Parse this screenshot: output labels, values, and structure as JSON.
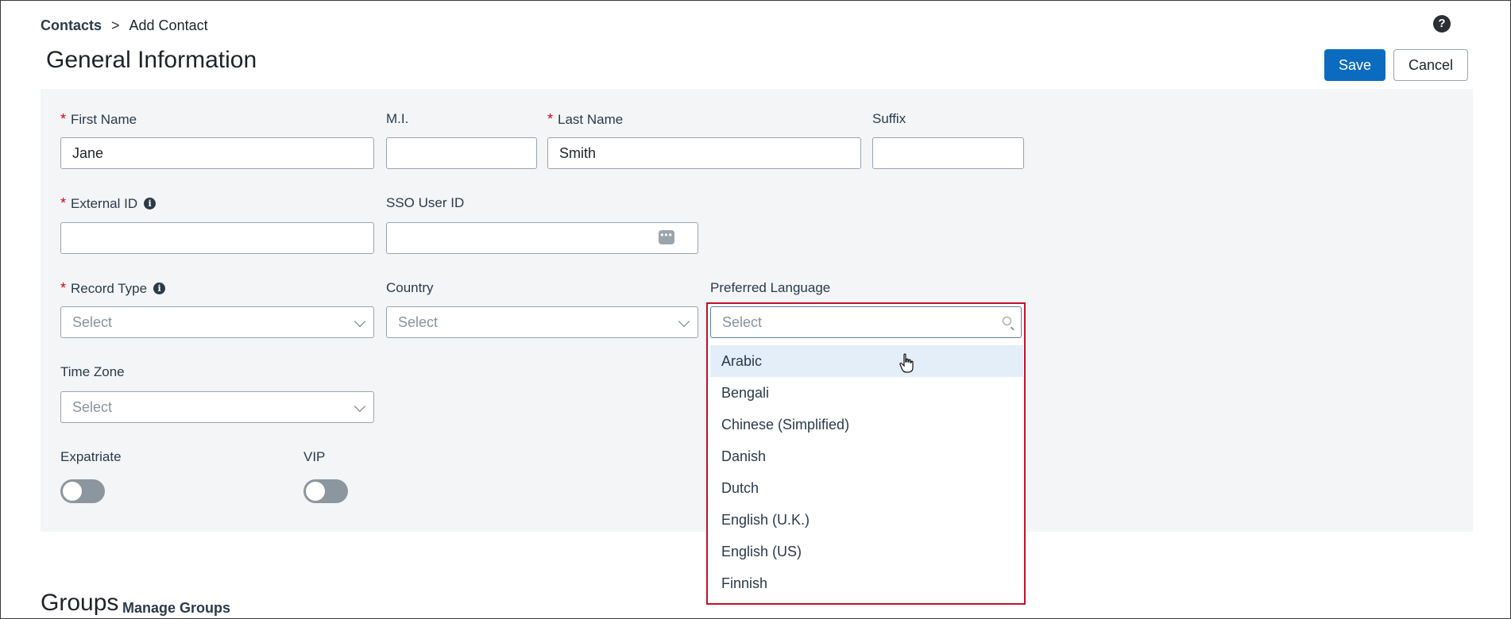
{
  "breadcrumb": {
    "parent": "Contacts",
    "separator": ">",
    "current": "Add Contact"
  },
  "help_icon": "?",
  "page_title": "General Information",
  "toolbar": {
    "save_label": "Save",
    "cancel_label": "Cancel"
  },
  "form": {
    "first_name": {
      "label": "First Name",
      "value": "Jane",
      "required": "*"
    },
    "mi": {
      "label": "M.I.",
      "value": ""
    },
    "last_name": {
      "label": "Last Name",
      "value": "Smith",
      "required": "*"
    },
    "suffix": {
      "label": "Suffix",
      "value": ""
    },
    "external_id": {
      "label": "External ID",
      "value": "",
      "required": "*",
      "info": "i"
    },
    "sso_user_id": {
      "label": "SSO User ID",
      "value": "",
      "dots": "•••"
    },
    "record_type": {
      "label": "Record Type",
      "placeholder": "Select",
      "required": "*",
      "info": "i"
    },
    "country": {
      "label": "Country",
      "placeholder": "Select"
    },
    "preferred_language": {
      "label": "Preferred Language",
      "placeholder": "Select",
      "options": [
        "Arabic",
        "Bengali",
        "Chinese (Simplified)",
        "Danish",
        "Dutch",
        "English (U.K.)",
        "English (US)",
        "Finnish"
      ]
    },
    "time_zone": {
      "label": "Time Zone",
      "placeholder": "Select"
    },
    "expatriate": {
      "label": "Expatriate"
    },
    "vip": {
      "label": "VIP"
    }
  },
  "groups": {
    "title": "Groups",
    "manage_label": "Manage Groups"
  }
}
